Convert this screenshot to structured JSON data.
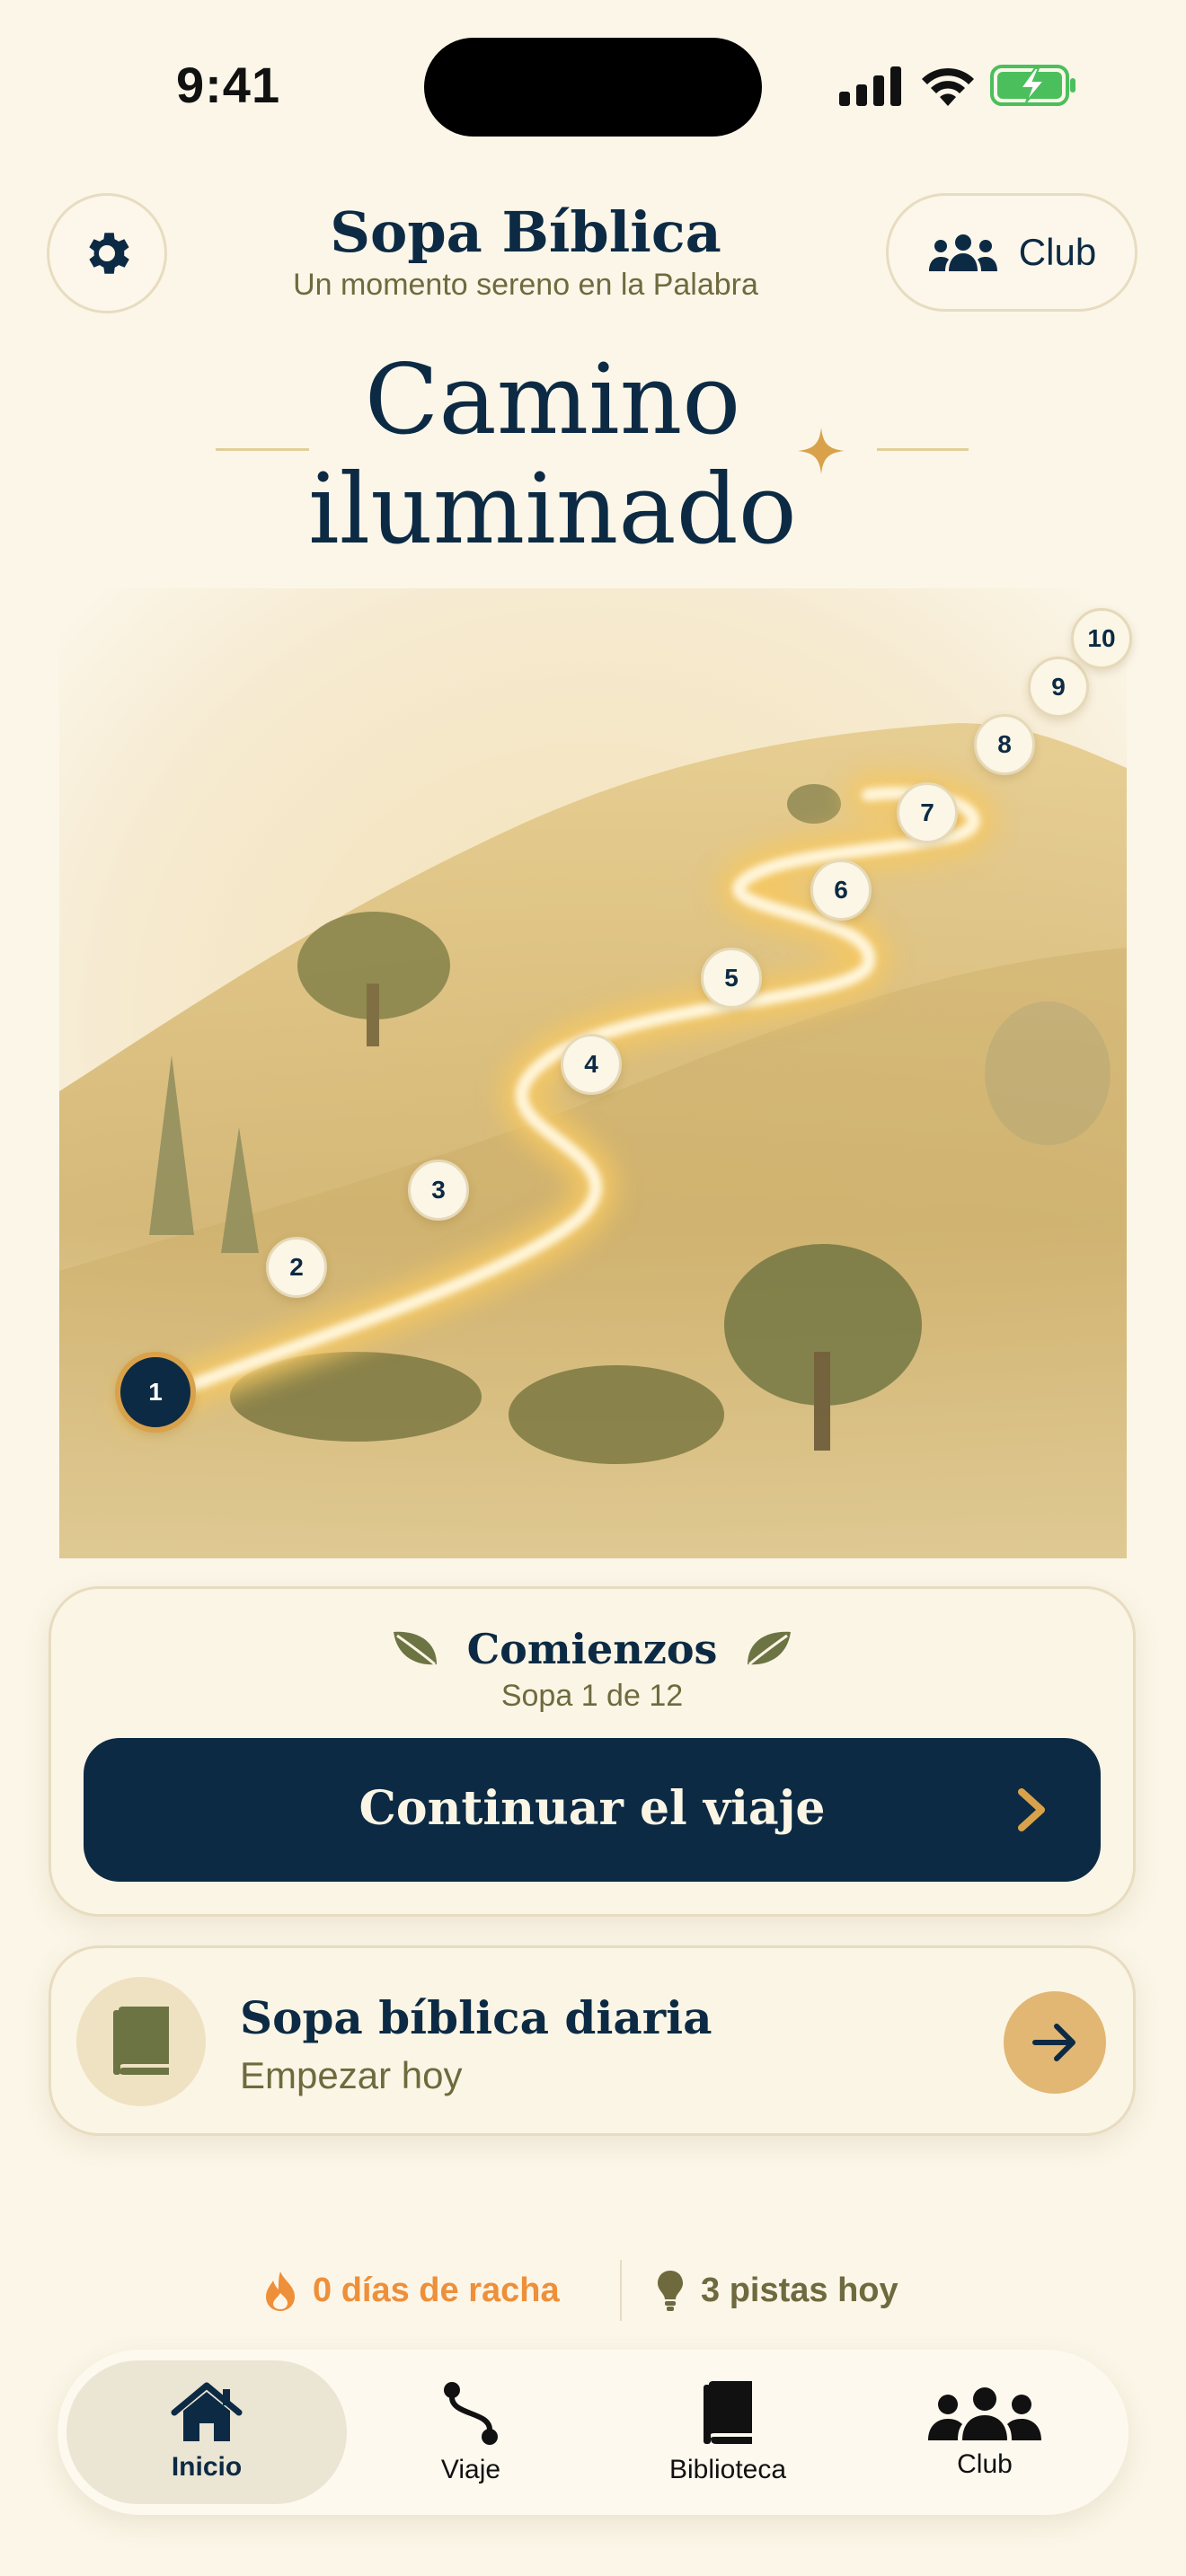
{
  "status_bar": {
    "time": "9:41",
    "icons": [
      "signal-icon",
      "wifi-icon",
      "battery-charging-icon"
    ]
  },
  "header": {
    "app_title": "Sopa Bíblica",
    "app_subtitle": "Un momento sereno en la Palabra",
    "settings_icon": "gear-icon",
    "club_button": {
      "icon": "group-icon",
      "label": "Club"
    }
  },
  "page": {
    "title_line1": "Camino",
    "title_line2": "iluminado"
  },
  "journey_map": {
    "stages": [
      "1",
      "2",
      "3",
      "4",
      "5",
      "6",
      "7",
      "8",
      "9",
      "10"
    ],
    "current_stage": "1"
  },
  "chapter_card": {
    "name": "Comienzos",
    "progress": "Sopa 1 de 12",
    "continue_label": "Continuar el viaje",
    "colors": {
      "button": "#0c2a44",
      "chevron": "#d9a24a",
      "leaf": "#6d7443"
    }
  },
  "daily_card": {
    "title": "Sopa bíblica diaria",
    "subtitle": "Empezar hoy",
    "icon": "book-icon",
    "arrow_icon": "arrow-right-icon"
  },
  "streak": {
    "days_label": "0 días de racha",
    "hints_label": "3 pistas hoy",
    "colors": {
      "streak": "#ee8f3a",
      "hints": "#6f6a3e"
    }
  },
  "tabbar": {
    "active": "Inicio",
    "tabs": [
      {
        "label": "Inicio",
        "icon": "home-icon"
      },
      {
        "label": "Viaje",
        "icon": "route-icon"
      },
      {
        "label": "Biblioteca",
        "icon": "book-icon"
      },
      {
        "label": "Club",
        "icon": "group-icon"
      }
    ]
  }
}
